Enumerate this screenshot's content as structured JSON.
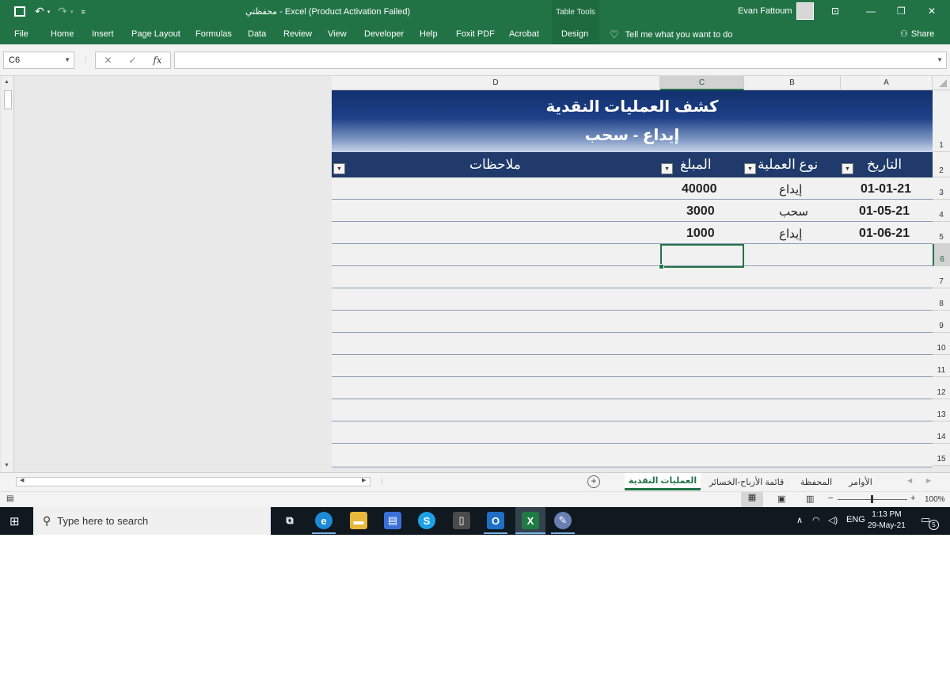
{
  "titlebar": {
    "title": "محفظتي  -  Excel (Product Activation Failed)",
    "table_tools": "Table Tools",
    "user": "Evan Fattoum",
    "save_icon": "save-icon",
    "undo_icon": "undo-icon",
    "redo_icon": "redo-icon"
  },
  "ribbon": {
    "tabs": [
      "File",
      "Home",
      "Insert",
      "Page Layout",
      "Formulas",
      "Data",
      "Review",
      "View",
      "Developer",
      "Help",
      "Foxit PDF",
      "Acrobat",
      "Design"
    ],
    "tell_me": "Tell me what you want to do",
    "share": "Share"
  },
  "formula_bar": {
    "name_box": "C6",
    "fx": "fx",
    "value": ""
  },
  "columns": [
    "D",
    "C",
    "B",
    "A"
  ],
  "rows": [
    "1",
    "2",
    "3",
    "4",
    "5",
    "6",
    "7",
    "8",
    "9",
    "10",
    "11",
    "12",
    "13",
    "14",
    "15"
  ],
  "sheet": {
    "title": "كشف العمليات النقدية",
    "subtitle": "إيداع - سحب",
    "headers": {
      "date": "التاريخ",
      "type": "نوع العملية",
      "amount": "المبلغ",
      "notes": "ملاحظات"
    },
    "records": [
      {
        "date": "01-01-21",
        "type": "إيداع",
        "amount": "40000"
      },
      {
        "date": "01-05-21",
        "type": "سحب",
        "amount": "3000"
      },
      {
        "date": "01-06-21",
        "type": "إيداع",
        "amount": "1000"
      }
    ]
  },
  "sheet_tabs": [
    "العمليات النقدية",
    "قائمة الأرباح-الخسائر",
    "المحفظة",
    "الأوامر"
  ],
  "status": {
    "zoom": "100%"
  },
  "taskbar": {
    "search_placeholder": "Type here to search",
    "lang": "ENG",
    "time": "1:13 PM",
    "date": "29-May-21",
    "notifications": "5"
  }
}
